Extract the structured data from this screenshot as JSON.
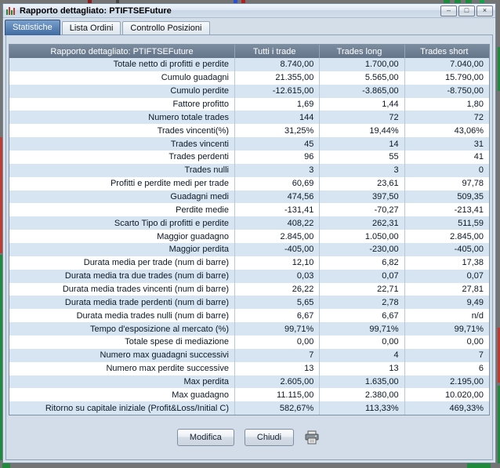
{
  "window": {
    "title": "Rapporto dettagliato: PTIFTSEFuture",
    "controls": [
      {
        "name": "minimize",
        "glyph": "–"
      },
      {
        "name": "maximize",
        "glyph": "□"
      },
      {
        "name": "close",
        "glyph": "×"
      }
    ]
  },
  "tabs": [
    {
      "label": "Statistiche",
      "active": true
    },
    {
      "label": "Lista Ordini",
      "active": false
    },
    {
      "label": "Controllo Posizioni",
      "active": false
    }
  ],
  "table": {
    "columns": [
      "Rapporto dettagliato: PTIFTSEFuture",
      "Tutti i trade",
      "Trades long",
      "Trades short"
    ],
    "rows": [
      [
        "Totale netto di profitti e perdite",
        "8.740,00",
        "1.700,00",
        "7.040,00"
      ],
      [
        "Cumulo guadagni",
        "21.355,00",
        "5.565,00",
        "15.790,00"
      ],
      [
        "Cumulo perdite",
        "-12.615,00",
        "-3.865,00",
        "-8.750,00"
      ],
      [
        "Fattore profitto",
        "1,69",
        "1,44",
        "1,80"
      ],
      [
        "Numero totale trades",
        "144",
        "72",
        "72"
      ],
      [
        "Trades vincenti(%)",
        "31,25%",
        "19,44%",
        "43,06%"
      ],
      [
        "Trades vincenti",
        "45",
        "14",
        "31"
      ],
      [
        "Trades perdenti",
        "96",
        "55",
        "41"
      ],
      [
        "Trades nulli",
        "3",
        "3",
        "0"
      ],
      [
        "Profitti e perdite medi per trade",
        "60,69",
        "23,61",
        "97,78"
      ],
      [
        "Guadagni medi",
        "474,56",
        "397,50",
        "509,35"
      ],
      [
        "Perdite medie",
        "-131,41",
        "-70,27",
        "-213,41"
      ],
      [
        "Scarto Tipo di profitti e perdite",
        "408,22",
        "262,31",
        "511,59"
      ],
      [
        "Maggior guadagno",
        "2.845,00",
        "1.050,00",
        "2.845,00"
      ],
      [
        "Maggior perdita",
        "-405,00",
        "-230,00",
        "-405,00"
      ],
      [
        "Durata media per trade (num di barre)",
        "12,10",
        "6,82",
        "17,38"
      ],
      [
        "Durata media tra due trades (num di barre)",
        "0,03",
        "0,07",
        "0,07"
      ],
      [
        "Durata media trades vincenti (num di barre)",
        "26,22",
        "22,71",
        "27,81"
      ],
      [
        "Durata media trade perdenti (num di barre)",
        "5,65",
        "2,78",
        "9,49"
      ],
      [
        "Durata media trades nulli (num di barre)",
        "6,67",
        "6,67",
        "n/d"
      ],
      [
        "Tempo d'esposizione al mercato (%)",
        "99,71%",
        "99,71%",
        "99,71%"
      ],
      [
        "Totale spese di mediazione",
        "0,00",
        "0,00",
        "0,00"
      ],
      [
        "Numero max guadagni successivi",
        "7",
        "4",
        "7"
      ],
      [
        "Numero max perdite successive",
        "13",
        "13",
        "6"
      ],
      [
        "Max perdita",
        "2.605,00",
        "1.635,00",
        "2.195,00"
      ],
      [
        "Max guadagno",
        "11.115,00",
        "2.380,00",
        "10.020,00"
      ],
      [
        "Ritorno su capitale iniziale (Profit&Loss/Initial C)",
        "582,67%",
        "113,33%",
        "469,33%"
      ]
    ]
  },
  "footer": {
    "buttons": [
      {
        "label": "Modifica"
      },
      {
        "label": "Chiudi"
      }
    ]
  },
  "icons": {
    "app": "chart-icon",
    "print": "printer-icon"
  },
  "colors": {
    "header_bg": "#6b7c8f",
    "row_alt": "#d7e5f2",
    "tab_active": "#4a74a8",
    "chart_green": "#1f8a3a",
    "chart_red": "#c03a2e"
  }
}
